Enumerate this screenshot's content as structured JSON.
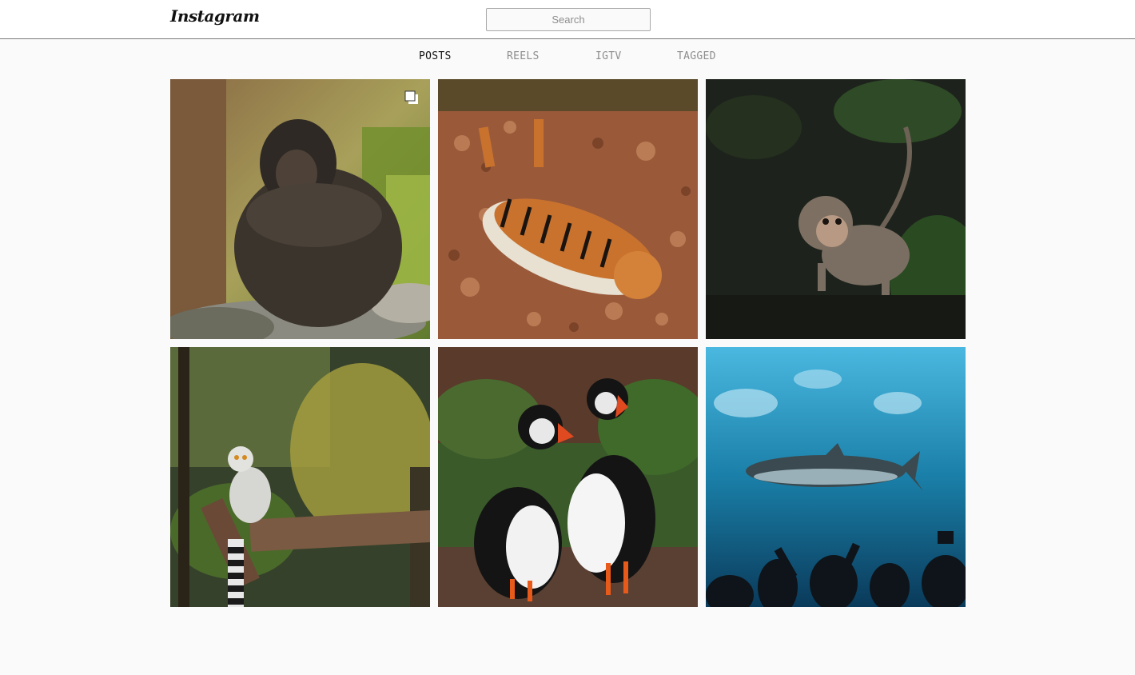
{
  "header": {
    "logo_text": "Instagram",
    "search_placeholder": "Search"
  },
  "tabs": [
    {
      "label": "POSTS",
      "active": true
    },
    {
      "label": "REELS",
      "active": false
    },
    {
      "label": "IGTV",
      "active": false
    },
    {
      "label": "TAGGED",
      "active": false
    }
  ],
  "posts": [
    {
      "subject": "chimpanzee",
      "multiple": true
    },
    {
      "subject": "tiger",
      "multiple": false
    },
    {
      "subject": "baby-monkey",
      "multiple": false
    },
    {
      "subject": "ring-tailed-lemur",
      "multiple": false
    },
    {
      "subject": "puffins",
      "multiple": false
    },
    {
      "subject": "shark-aquarium",
      "multiple": false
    }
  ],
  "icons": {
    "multiple_posts": "carousel-icon"
  }
}
